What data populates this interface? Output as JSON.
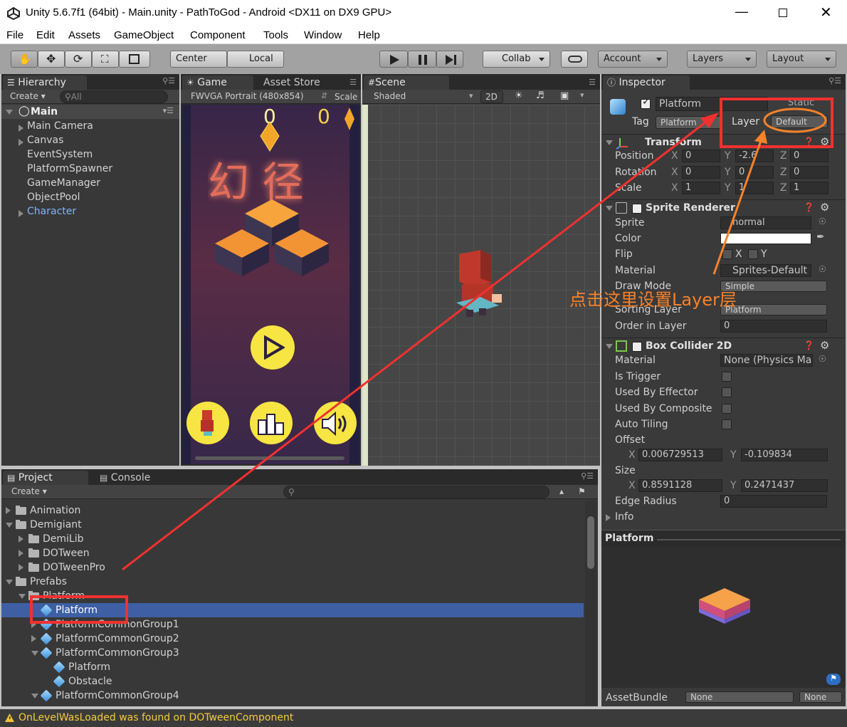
{
  "window": {
    "title": "Unity 5.6.7f1 (64bit) - Main.unity - PathToGod - Android <DX11 on DX9 GPU>"
  },
  "menu": [
    "File",
    "Edit",
    "Assets",
    "GameObject",
    "Component",
    "Tools",
    "Window",
    "Help"
  ],
  "toolbar": {
    "center": "Center",
    "local": "Local",
    "collab": "Collab",
    "account": "Account",
    "layers": "Layers",
    "layout": "Layout"
  },
  "hierarchy": {
    "tab": "Hierarchy",
    "create": "Create",
    "search": "All",
    "scene": "Main",
    "items": [
      "Main Camera",
      "Canvas",
      "EventSystem",
      "PlatformSpawner",
      "GameManager",
      "ObjectPool",
      "Character"
    ]
  },
  "game": {
    "tab": "Game",
    "tab2": "Asset Store",
    "resolution": "FWVGA Portrait (480x854)",
    "scale": "Scale",
    "score_left": "0",
    "score_right": "0",
    "title_cn": "幻 径"
  },
  "scene": {
    "tab": "Scene",
    "shading": "Shaded",
    "mode2d": "2D"
  },
  "inspector": {
    "tab": "Inspector",
    "name": "Platform",
    "static": "Static",
    "tag_label": "Tag",
    "tag": "Platform",
    "layer_label": "Layer",
    "layer": "Default",
    "transform": {
      "title": "Transform",
      "rows": [
        {
          "label": "Position",
          "x": "0",
          "y": "-2.6",
          "z": "0"
        },
        {
          "label": "Rotation",
          "x": "0",
          "y": "0",
          "z": "0"
        },
        {
          "label": "Scale",
          "x": "1",
          "y": "1",
          "z": "1"
        }
      ]
    },
    "sprite_renderer": {
      "title": "Sprite Renderer",
      "sprite_label": "Sprite",
      "sprite": "normal",
      "color_label": "Color",
      "flip_label": "Flip",
      "flip_x": "X",
      "flip_y": "Y",
      "material_label": "Material",
      "material": "Sprites-Default",
      "draw_mode_label": "Draw Mode",
      "draw_mode": "Simple",
      "sorting_layer_label": "Sorting Layer",
      "sorting_layer": "Platform",
      "order_label": "Order in Layer",
      "order": "0"
    },
    "box_collider": {
      "title": "Box Collider 2D",
      "material_label": "Material",
      "material": "None (Physics Ma",
      "trigger_label": "Is Trigger",
      "effector_label": "Used By Effector",
      "composite_label": "Used By Composite",
      "tiling_label": "Auto Tiling",
      "offset_label": "Offset",
      "offset_x": "0.006729513",
      "offset_y": "-0.109834",
      "size_label": "Size",
      "size_x": "0.8591128",
      "size_y": "0.2471437",
      "edge_label": "Edge Radius",
      "edge": "0",
      "info_label": "Info"
    },
    "preview_title": "Platform",
    "assetbundle_label": "AssetBundle",
    "assetbundle": "None",
    "assetbundle_variant": "None"
  },
  "project": {
    "tab": "Project",
    "tab2": "Console",
    "create": "Create",
    "items": [
      {
        "label": "Animation",
        "indent": 0,
        "type": "folder",
        "arrow": "right"
      },
      {
        "label": "Demigiant",
        "indent": 0,
        "type": "folder",
        "arrow": "down"
      },
      {
        "label": "DemiLib",
        "indent": 1,
        "type": "folder",
        "arrow": "right"
      },
      {
        "label": "DOTween",
        "indent": 1,
        "type": "folder",
        "arrow": "right"
      },
      {
        "label": "DOTweenPro",
        "indent": 1,
        "type": "folder",
        "arrow": "right"
      },
      {
        "label": "Prefabs",
        "indent": 0,
        "type": "folder",
        "arrow": "down"
      },
      {
        "label": "Platform",
        "indent": 1,
        "type": "folder",
        "arrow": "down"
      },
      {
        "label": "Platform",
        "indent": 2,
        "type": "prefab",
        "arrow": "",
        "selected": true
      },
      {
        "label": "PlatformCommonGroup1",
        "indent": 2,
        "type": "prefab",
        "arrow": "right"
      },
      {
        "label": "PlatformCommonGroup2",
        "indent": 2,
        "type": "prefab",
        "arrow": "right"
      },
      {
        "label": "PlatformCommonGroup3",
        "indent": 2,
        "type": "prefab",
        "arrow": "down"
      },
      {
        "label": "Platform",
        "indent": 3,
        "type": "prefab",
        "arrow": ""
      },
      {
        "label": "Obstacle",
        "indent": 3,
        "type": "prefab",
        "arrow": ""
      },
      {
        "label": "PlatformCommonGroup4",
        "indent": 2,
        "type": "prefab",
        "arrow": "down"
      }
    ]
  },
  "status": {
    "message": "OnLevelWasLoaded was found on DOTweenComponent"
  },
  "annotation": {
    "note": "点击这里设置Layer层",
    "red": "#f0312f",
    "orange": "#f7822a"
  }
}
